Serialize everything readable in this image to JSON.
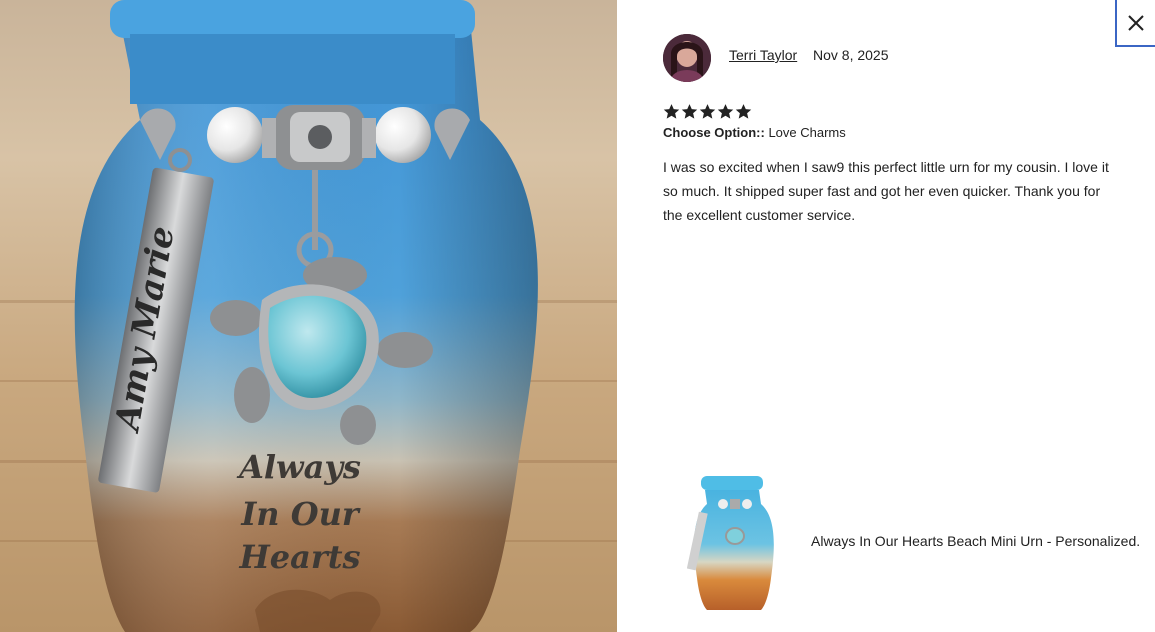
{
  "photo": {
    "tag_text": "Amy Marie",
    "engraving_line1": "Always",
    "engraving_line2": "In Our",
    "engraving_line3": "Hearts"
  },
  "review": {
    "reviewer_name": "Terri Taylor",
    "date": "Nov 8, 2025",
    "rating": 5,
    "rating_max": 5,
    "option_label": "Choose Option::",
    "option_value": "Love Charms",
    "text": "I was so excited when I saw9 this perfect little urn for my cousin. I love it so much. It shipped super fast and got her even quicker. Thank you for the excellent customer service."
  },
  "product": {
    "title": "Always In Our Hearts Beach Mini Urn - Personalized."
  },
  "icons": {
    "close": "close-icon",
    "star": "star-icon"
  },
  "colors": {
    "close_border": "#3b66c4",
    "urn_blue": "#3e8fcf",
    "sand": "#b98a5c"
  }
}
